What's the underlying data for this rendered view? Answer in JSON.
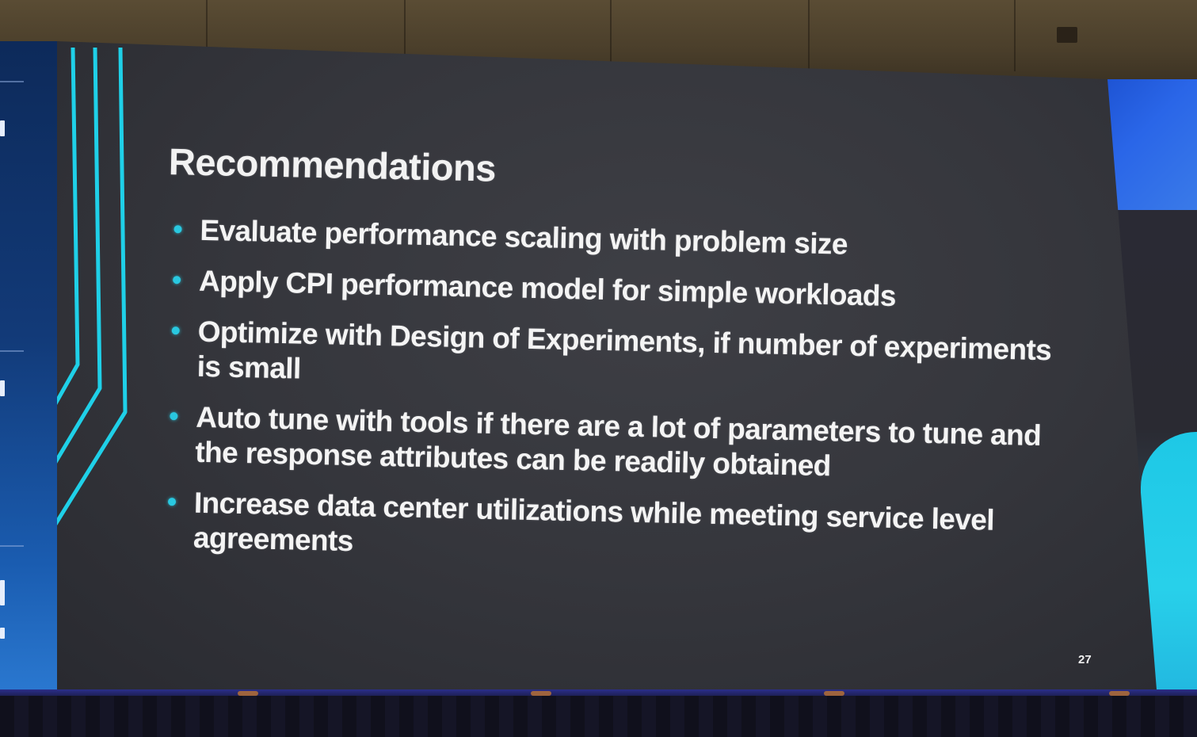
{
  "slide": {
    "title": "Recommendations",
    "bullets": [
      "Evaluate performance scaling with problem size",
      "Apply CPI performance model for simple workloads",
      "Optimize with Design of Experiments, if number of experiments is small",
      "Auto tune with tools if there are a lot of parameters to tune and the response attributes can be readily obtained",
      "Increase data center utilizations while meeting service level agreements"
    ],
    "page_number": "27"
  },
  "colors": {
    "slide_background": "#35363c",
    "text": "#f4f4f4",
    "bullet_accent": "#29c8e0",
    "accent_lines": "#1fd0e8",
    "side_screen_blue": "#2a66e8"
  }
}
